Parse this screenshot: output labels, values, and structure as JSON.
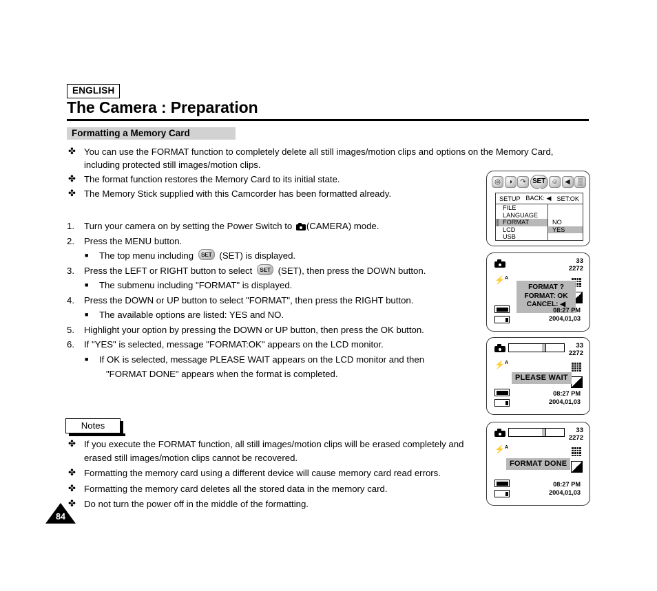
{
  "header": {
    "language_badge": "ENGLISH",
    "title": "The Camera : Preparation",
    "section": "Formatting a Memory Card"
  },
  "intro_bullets": [
    "You can use the FORMAT function to completely delete all still images/motion clips and options on the Memory Card, including protected still images/motion clips.",
    "The format function restores the Memory Card to its initial state.",
    "The Memory Stick supplied with this Camcorder has been formatted already."
  ],
  "steps": [
    {
      "num": "1.",
      "pre": "Turn your camera on by setting the Power Switch to ",
      "icon": "camera-icon",
      "post": "(CAMERA) mode."
    },
    {
      "num": "2.",
      "pre": "Press the MENU button.",
      "icon": "",
      "post": ""
    },
    {
      "num": "3.",
      "pre": "Press the LEFT or RIGHT button to select ",
      "icon": "set-chip-icon",
      "post": " (SET), then press the DOWN button."
    },
    {
      "num": "4.",
      "pre": "Press the DOWN or UP button to select  \"FORMAT\",  then press the RIGHT button.",
      "icon": "",
      "post": ""
    },
    {
      "num": "5.",
      "pre": "Highlight your option by pressing the DOWN or UP button, then press the OK button.",
      "icon": "",
      "post": ""
    },
    {
      "num": "6.",
      "pre": "If \"YES\" is selected, message \"FORMAT:OK\" appears on the LCD monitor.",
      "icon": "",
      "post": ""
    }
  ],
  "substeps": {
    "s2": {
      "pre": "The top menu including ",
      "icon": "set-chip-icon",
      "post": " (SET) is displayed."
    },
    "s3": "The submenu including  \"FORMAT\" is displayed.",
    "s4": "The available options are listed: YES and NO.",
    "s6_line1": "If  OK  is selected, message  PLEASE WAIT  appears on the LCD monitor and then",
    "s6_line2": "\"FORMAT DONE\" appears when the format is completed."
  },
  "notes": {
    "label": "Notes",
    "items": [
      "If you execute the FORMAT function, all still images/motion clips will be erased completely and erased still images/motion clips cannot be recovered.",
      "Formatting the memory card using a different device will cause memory card read errors.",
      "Formatting the memory card deletes all the stored data in the memory card.",
      "Do not turn the power off in the middle of the formatting."
    ]
  },
  "page_number": "84",
  "bullet_glyph": "✤",
  "square_glyph": "■",
  "lcd": {
    "panel1": {
      "icons": [
        {
          "name": "camera-mode-icon",
          "glyph": "◎"
        },
        {
          "name": "self-timer-icon",
          "glyph": "◑"
        },
        {
          "name": "playback-icon",
          "glyph": "↷"
        },
        {
          "name": "set-menu-icon",
          "glyph": "SET"
        },
        {
          "name": "user-profile-icon",
          "glyph": "☺"
        },
        {
          "name": "speaker-icon",
          "glyph": "◀"
        },
        {
          "name": "grid-icon",
          "glyph": "▒"
        }
      ],
      "header": {
        "left": "SETUP",
        "mid": "BACK: ◀",
        "right": "SET:OK"
      },
      "menu_items": [
        {
          "label": "FILE",
          "selected": false
        },
        {
          "label": "LANGUAGE",
          "selected": false
        },
        {
          "label": "FORMAT",
          "selected": true
        },
        {
          "label": "LCD",
          "selected": false
        },
        {
          "label": "USB",
          "selected": false
        }
      ],
      "options": [
        {
          "label": "NO",
          "selected": false
        },
        {
          "label": "YES",
          "selected": true
        }
      ]
    },
    "panel2": {
      "count": "33",
      "resolution": "2272",
      "flash": "A",
      "dialog": [
        "FORMAT ?",
        "FORMAT: OK",
        "CANCEL: ◀"
      ],
      "time": "08:27 PM",
      "date": "2004,01,03"
    },
    "panel3": {
      "count": "33",
      "resolution": "2272",
      "flash": "A",
      "message": "PLEASE WAIT",
      "time": "08:27 PM",
      "date": "2004,01,03"
    },
    "panel4": {
      "count": "33",
      "resolution": "2272",
      "flash": "A",
      "message": "FORMAT DONE",
      "time": "08:27 PM",
      "date": "2004,01,03"
    }
  },
  "colors": {
    "band_gray": "#d2d2d2",
    "highlight_gray": "#b8b8b8",
    "ink": "#000000"
  }
}
